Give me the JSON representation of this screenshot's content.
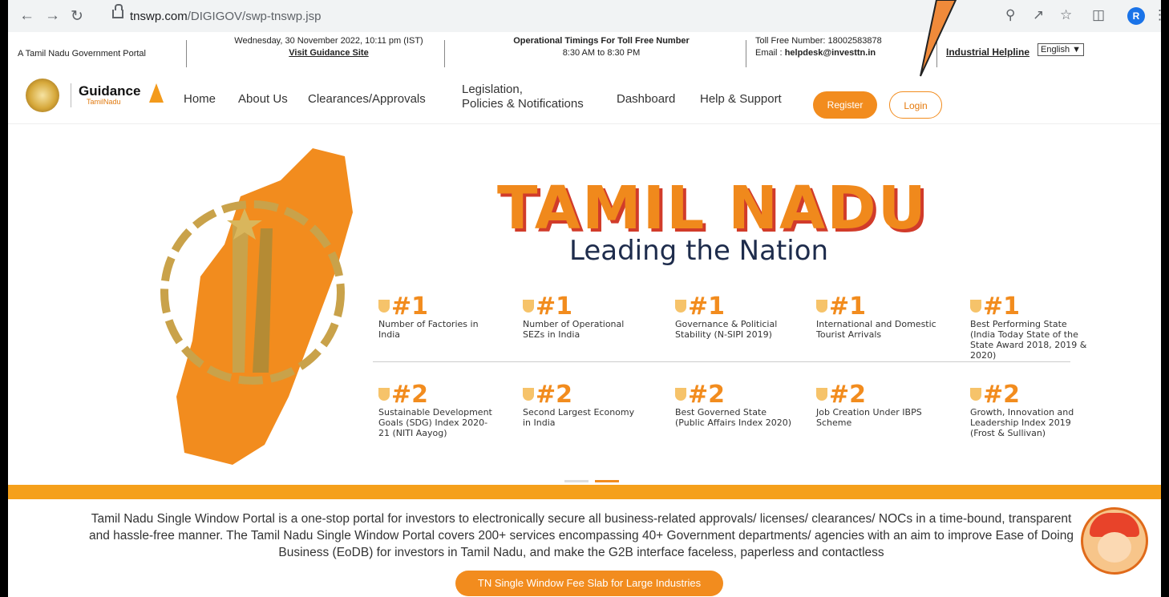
{
  "browser": {
    "url_host": "tnswp.com",
    "url_path": "/DIGIGOV/swp-tnswp.jsp",
    "avatar": "R",
    "icons": [
      "back-icon",
      "forward-icon",
      "reload-icon",
      "zoom-icon",
      "share-icon",
      "bookmark-star-icon",
      "side-panel-icon",
      "menu-kebab-icon"
    ]
  },
  "infobar": {
    "portal": "A Tamil Nadu Government Portal",
    "datetime": "Wednesday, 30 November 2022, 10:11 pm (IST)",
    "guidance_link": "Visit Guidance Site",
    "timings_title": "Operational Timings For Toll Free Number",
    "timings": "8:30 AM to 8:30 PM",
    "tollfree": "Toll Free Number: 18002583878",
    "email_label": "Email : ",
    "email": "helpdesk@investtn.in",
    "helpline": "Industrial Helpline",
    "language": "English"
  },
  "brand": {
    "name": "Guidance",
    "sub": "TamilNadu"
  },
  "nav": {
    "home": "Home",
    "about": "About Us",
    "clearances": "Clearances/Approvals",
    "legislation_1": "Legislation,",
    "legislation_2": "Policies & Notifications",
    "dashboard": "Dashboard",
    "help": "Help & Support",
    "register": "Register",
    "login": "Login"
  },
  "hero": {
    "title": "TAMIL NADU",
    "subtitle": "Leading the Nation",
    "row1": [
      {
        "rank": "#1",
        "desc": "Number of Factories in India"
      },
      {
        "rank": "#1",
        "desc": "Number of Operational SEZs in India"
      },
      {
        "rank": "#1",
        "desc": "Governance & Politicial Stability (N-SIPI 2019)"
      },
      {
        "rank": "#1",
        "desc": "International and Domestic Tourist Arrivals"
      },
      {
        "rank": "#1",
        "desc": "Best Performing State (India Today State of the State Award 2018, 2019 & 2020)"
      }
    ],
    "row2": [
      {
        "rank": "#2",
        "desc": "Sustainable Development Goals (SDG) Index 2020-21 (NITI Aayog)"
      },
      {
        "rank": "#2",
        "desc": "Second Largest Economy in India"
      },
      {
        "rank": "#2",
        "desc": "Best Governed State (Public Affairs Index 2020)"
      },
      {
        "rank": "#2",
        "desc": "Job Creation Under IBPS Scheme"
      },
      {
        "rank": "#2",
        "desc": "Growth, Innovation and Leadership Index 2019 (Frost & Sullivan)"
      }
    ]
  },
  "description": "Tamil Nadu Single Window Portal is a one-stop portal for investors to electronically secure all business-related approvals/ licenses/ clearances/ NOCs in a time-bound, transparent and hassle-free manner. The Tamil Nadu Single Window Portal covers 200+ services encompassing 40+ Government departments/ agencies with an aim to improve Ease of Doing Business (EoDB) for investors in Tamil Nadu, and make the G2B interface faceless, paperless and contactless",
  "fee_button": "TN Single Window Fee Slab for Large Industries",
  "colors": {
    "accent": "#f28c1e",
    "title_shadow": "#d13b2a",
    "navy": "#1e2c4c"
  }
}
